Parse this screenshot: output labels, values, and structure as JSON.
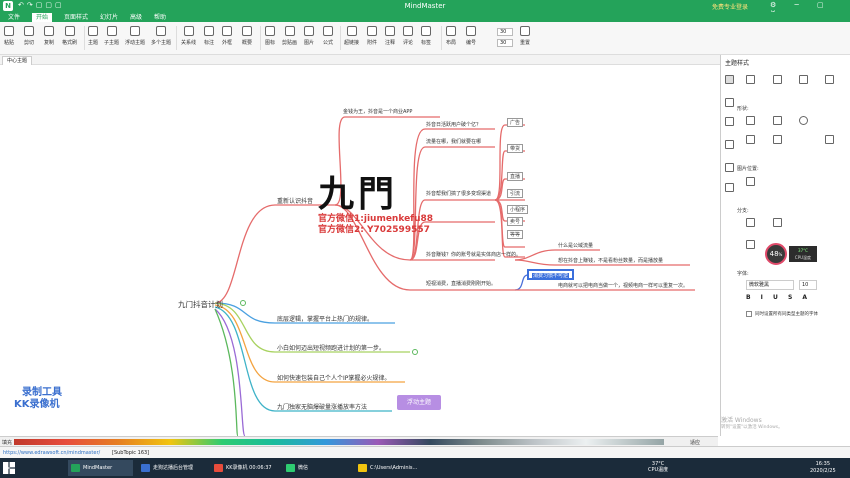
{
  "app": {
    "title": "MindMaster",
    "login": "免费专业登录"
  },
  "menu": [
    "文件",
    "开始",
    "页面样式",
    "幻灯片",
    "高级",
    "帮助"
  ],
  "ribbon": [
    "粘贴",
    "剪切",
    "复制",
    "格式刷",
    "主题",
    "子主题",
    "浮动主题",
    "多个主题",
    "关系线",
    "标注",
    "外框",
    "概要",
    "图标",
    "剪贴画",
    "图片",
    "公式",
    "超链接",
    "附件",
    "注释",
    "评论",
    "标签",
    "布局",
    "编号",
    "重置"
  ],
  "spinners": [
    "30",
    "30"
  ],
  "doc_tab": "中心主题",
  "mindmap": {
    "root": "九门抖音计划",
    "branches": [
      "重新认识抖音",
      "底层逻辑，掌握平台上热门的规律。",
      "小白如何迈出短视频跑进计划的第一步。",
      "如何快速包装自己个人个IP掌握必火规律。",
      "九门独家无脑爆破量涨播放率方法"
    ],
    "float_topic": "浮动主题",
    "sub": [
      "金钱为王，抖音是一个商业APP",
      "抖音日活跃用户破个亿？",
      "流量在哪，我们就要在哪",
      "抖音帮我们搞了很多变现渠道",
      "抖音赚钱？你的账号就是实体商店一样的。",
      "短视消费，直播消费刚刚开始。"
    ],
    "channels": [
      "广告",
      "带货",
      "直播",
      "引流",
      "小程序",
      "卖号",
      "等等"
    ],
    "details": [
      "什么是公域流量",
      "想在抖音上赚钱，不是看粉丝数量，而是播放量",
      "消费习惯不可逆",
      "电商就可以把电商当做一个，视频电商一样可以重复一次。"
    ]
  },
  "watermark": {
    "brand": "九門",
    "wechat1": "官方微信1:jiumenkefu88",
    "wechat2": "官方微信2: Y702599557",
    "recorder": "录制工具",
    "recorder_name": "KK录像机"
  },
  "panel": {
    "title": "主题样式",
    "shape": "形状:",
    "img_pos": "图片位置:",
    "branch": "分支:",
    "font": "字体:",
    "font_name": "微软雅黑",
    "font_size": "10",
    "checkbox": "同时设置所有同类型主题的字体",
    "gauge": "48",
    "gauge_unit": "%",
    "cpu_temp": "37°C",
    "cpu_label": "CPU温度"
  },
  "activate": {
    "line1": "激活 Windows",
    "line2": "转到\"设置\"以激活 Windows。"
  },
  "statusbar": {
    "url": "https://www.edrawsoft.cn/mindmaster/",
    "subtopic": "[SubTopic 163]",
    "fill": "填充",
    "fit": "适应"
  },
  "taskbar": {
    "items": [
      "MindMaster",
      "走狗达播后台管理",
      "KK录像机 00:06:37",
      "微信",
      "C:\\Users\\Adminis..."
    ],
    "temp": "37°C",
    "cpu": "CPU温度",
    "time": "16:35",
    "date": "2020/2/25"
  },
  "colors": {
    "accent": "#24a35a",
    "canvas_tab": "#6a4fa0",
    "float": "#b78ee3"
  }
}
